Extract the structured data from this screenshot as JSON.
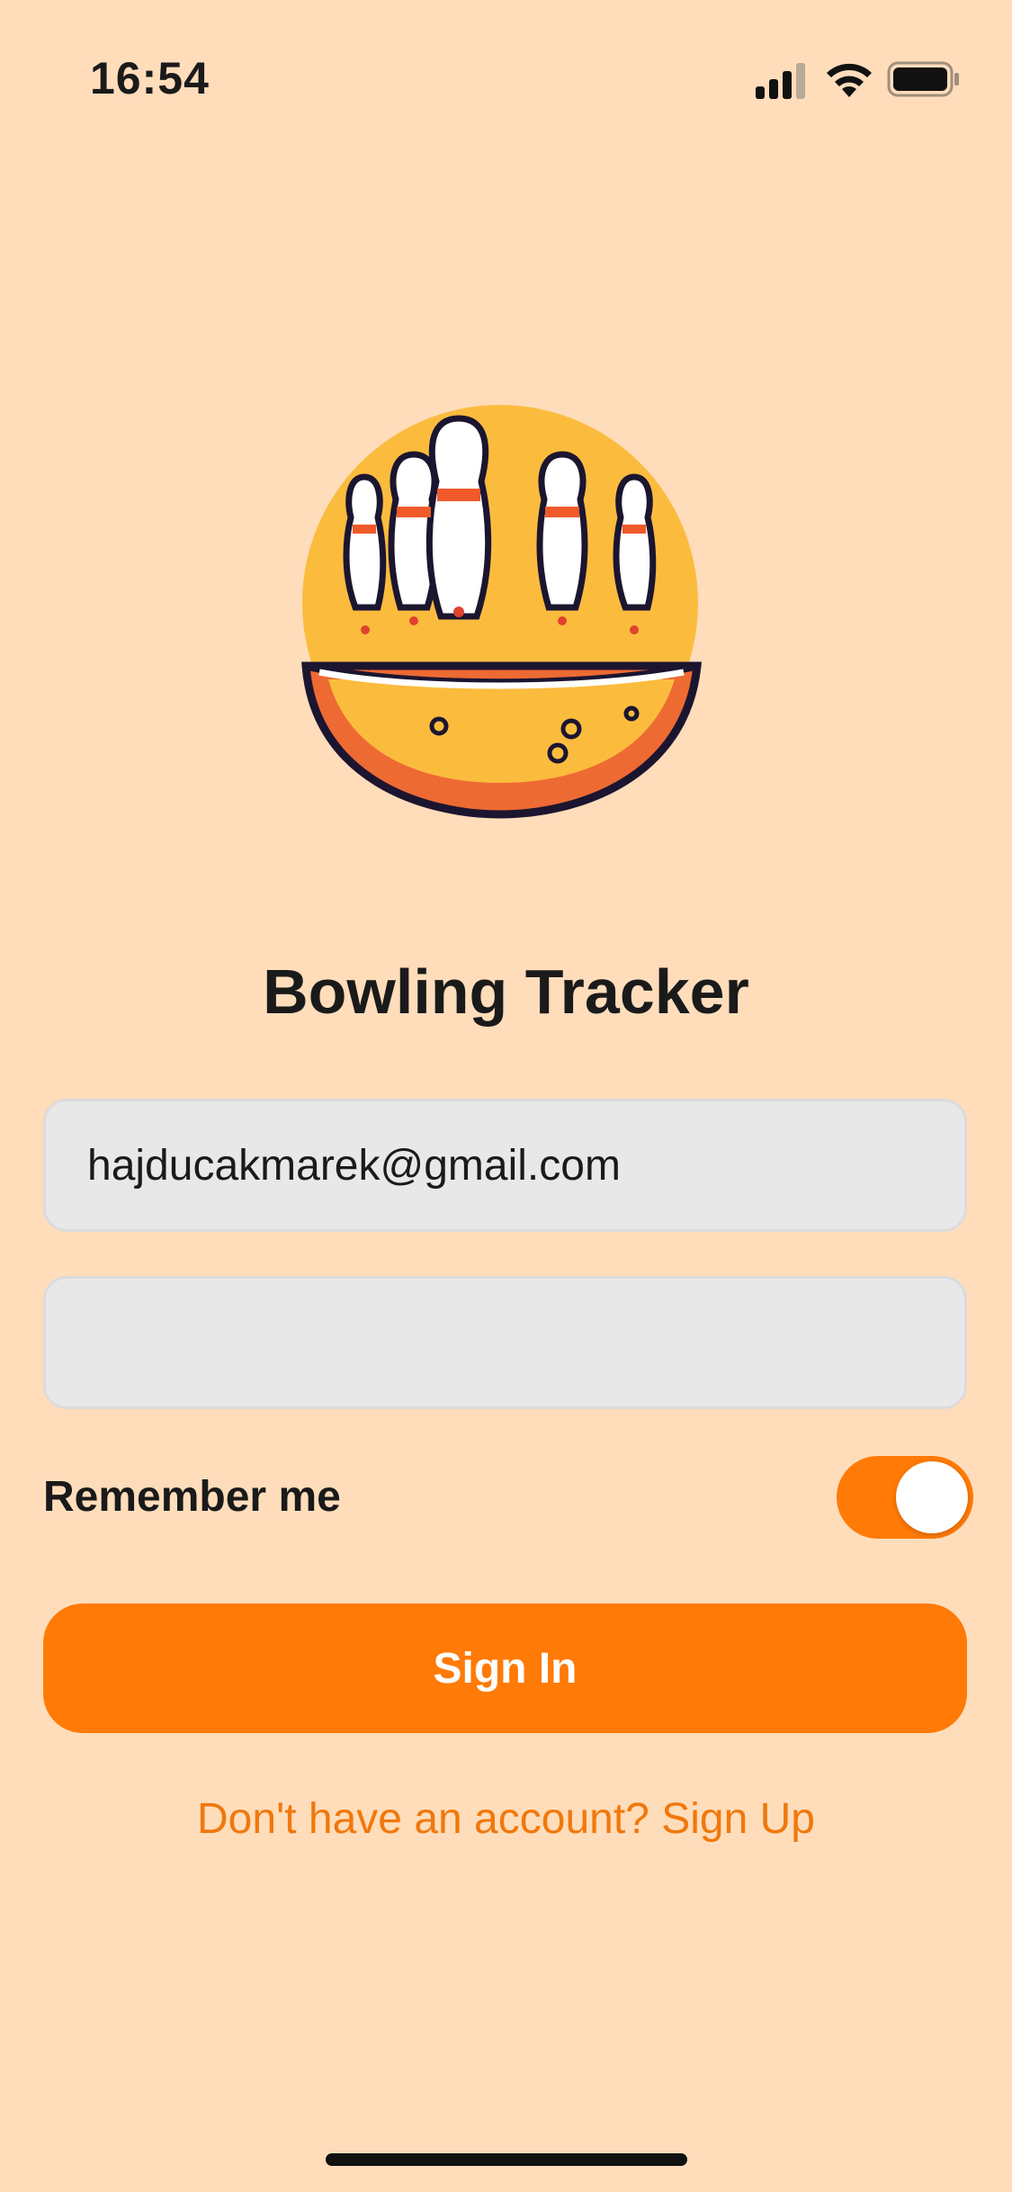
{
  "status_bar": {
    "time": "16:54",
    "icons": [
      "cellular-signal-icon",
      "wifi-icon",
      "battery-icon"
    ]
  },
  "app": {
    "title": "Bowling Tracker",
    "logo": "bowling-pins-logo"
  },
  "login": {
    "email_value": "hajducakmarek@gmail.com",
    "password_value": "",
    "remember_label": "Remember me",
    "remember_enabled": true,
    "signin_label": "Sign In",
    "signup_link": "Don't have an account? Sign Up"
  },
  "colors": {
    "background": "#FFDDBB",
    "accent": "#FF7A06",
    "field_background": "#E8E8E8"
  }
}
